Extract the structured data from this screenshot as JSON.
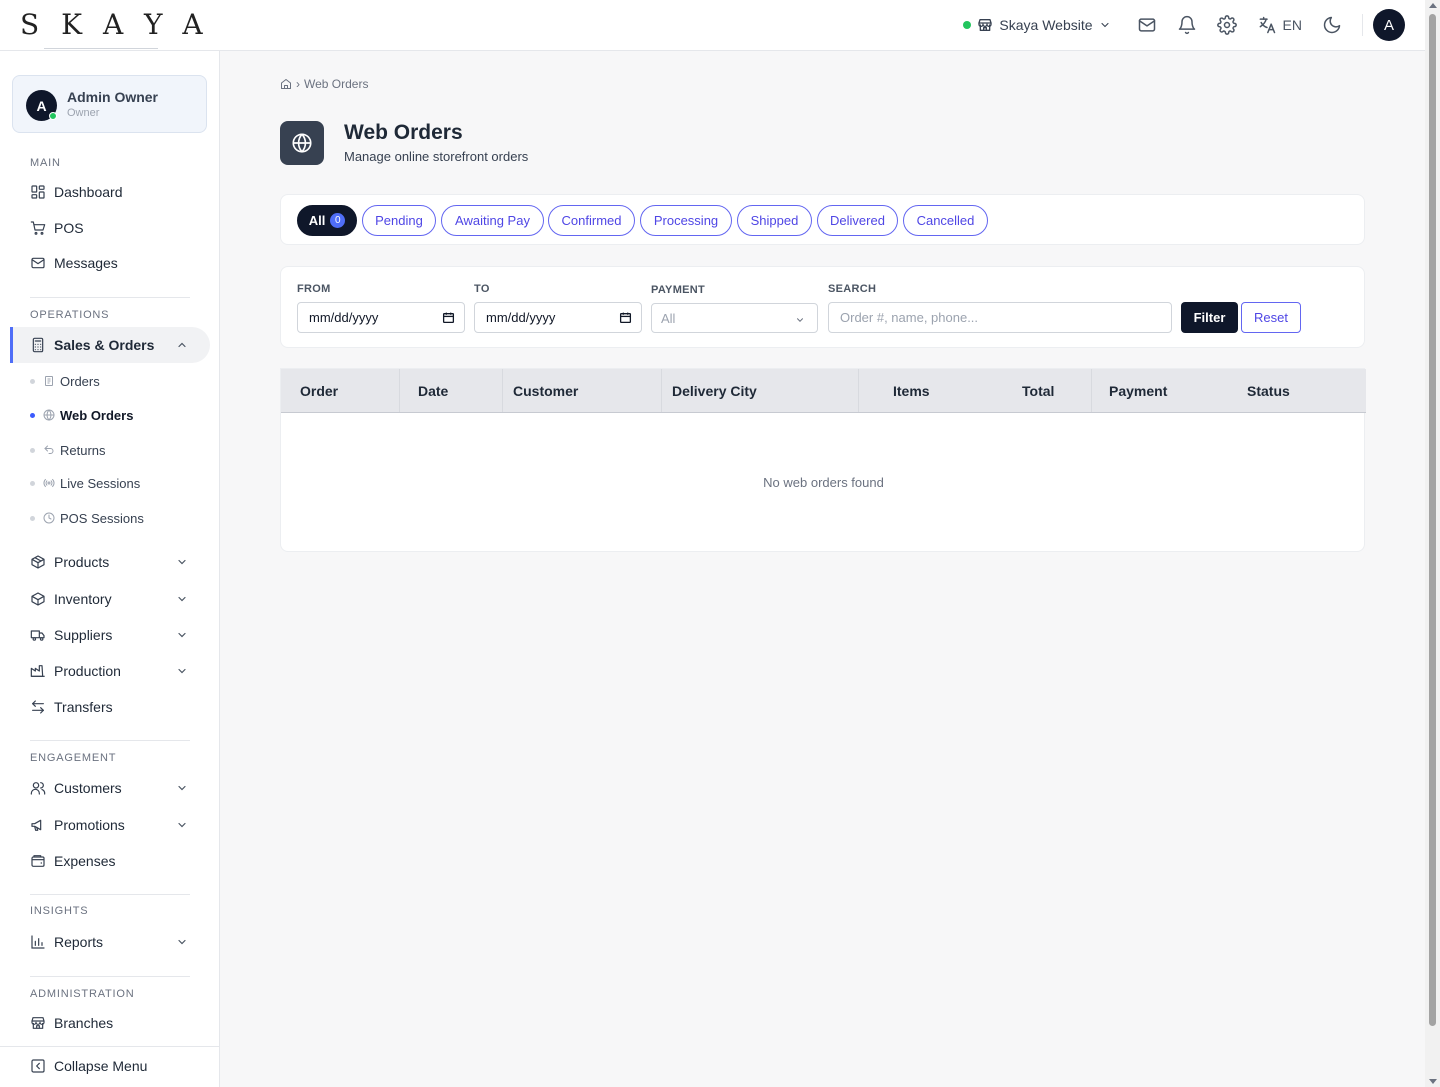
{
  "app": {
    "logo": "SKAYA",
    "store_selector": "Skaya Website",
    "language": "EN",
    "user_initial": "A"
  },
  "sidebar": {
    "user": {
      "initial": "A",
      "name": "Admin Owner",
      "role": "Owner"
    },
    "sections": {
      "main": "MAIN",
      "operations": "OPERATIONS",
      "engagement": "ENGAGEMENT",
      "insights": "INSIGHTS",
      "administration": "ADMINISTRATION"
    },
    "items": {
      "dashboard": "Dashboard",
      "pos": "POS",
      "messages": "Messages",
      "sales_orders": "Sales & Orders",
      "orders": "Orders",
      "web_orders": "Web Orders",
      "returns": "Returns",
      "live_sessions": "Live Sessions",
      "pos_sessions": "POS Sessions",
      "products": "Products",
      "inventory": "Inventory",
      "suppliers": "Suppliers",
      "production": "Production",
      "transfers": "Transfers",
      "customers": "Customers",
      "promotions": "Promotions",
      "expenses": "Expenses",
      "reports": "Reports",
      "branches": "Branches"
    },
    "collapse_label": "Collapse Menu"
  },
  "breadcrumb": {
    "current": "Web Orders"
  },
  "page": {
    "title": "Web Orders",
    "subtitle": "Manage online storefront orders"
  },
  "tabs": {
    "all": "All",
    "all_count": "0",
    "pending": "Pending",
    "awaiting_pay": "Awaiting Pay",
    "confirmed": "Confirmed",
    "processing": "Processing",
    "shipped": "Shipped",
    "delivered": "Delivered",
    "cancelled": "Cancelled"
  },
  "filters": {
    "from_label": "FROM",
    "from_value": "mm/dd/yyyy",
    "to_label": "TO",
    "to_value": "mm/dd/yyyy",
    "payment_label": "PAYMENT",
    "payment_value": "All",
    "search_label": "SEARCH",
    "search_placeholder": "Order #, name, phone...",
    "filter_button": "Filter",
    "reset_button": "Reset"
  },
  "table": {
    "columns": {
      "order": "Order",
      "date": "Date",
      "customer": "Customer",
      "delivery_city": "Delivery City",
      "items": "Items",
      "total": "Total",
      "payment": "Payment",
      "status": "Status"
    },
    "empty_message": "No web orders found"
  },
  "colors": {
    "accent": "#4f46e5",
    "dark": "#0f172a",
    "online": "#22c55e"
  }
}
